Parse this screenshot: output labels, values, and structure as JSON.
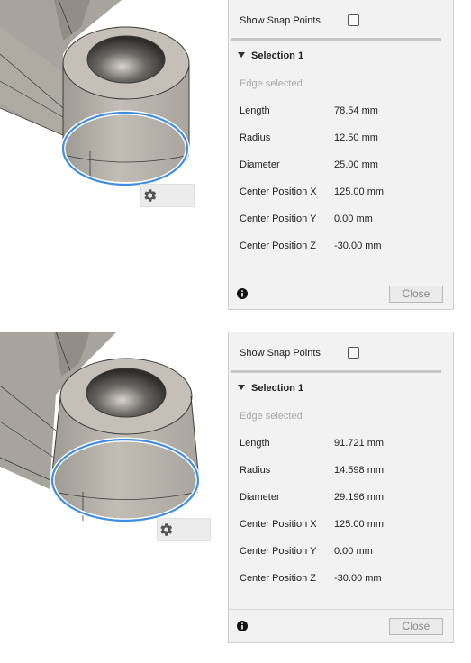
{
  "colors": {
    "accent": "#3e8ee0",
    "part_body": "#b6b2aa",
    "panel_bg": "#f2f2f2"
  },
  "screens": [
    {
      "viewport": {
        "selection_count": "1",
        "gear_icon": "gear-icon"
      },
      "panel": {
        "snap_label": "Show Snap Points",
        "snap_checked": false,
        "selection_title": "Selection 1",
        "status": "Edge selected",
        "props": [
          {
            "name": "Length",
            "value": "78.54 mm"
          },
          {
            "name": "Radius",
            "value": "12.50 mm"
          },
          {
            "name": "Diameter",
            "value": "25.00 mm"
          },
          {
            "name": "Center Position X",
            "value": "125.00 mm"
          },
          {
            "name": "Center Position Y",
            "value": "0.00 mm"
          },
          {
            "name": "Center Position Z",
            "value": "-30.00 mm"
          }
        ],
        "close_label": "Close",
        "info_icon": "info-icon"
      }
    },
    {
      "viewport": {
        "selection_count": "1",
        "gear_icon": "gear-icon"
      },
      "panel": {
        "snap_label": "Show Snap Points",
        "snap_checked": false,
        "selection_title": "Selection 1",
        "status": "Edge selected",
        "props": [
          {
            "name": "Length",
            "value": "91.721 mm"
          },
          {
            "name": "Radius",
            "value": "14.598 mm"
          },
          {
            "name": "Diameter",
            "value": "29.196 mm"
          },
          {
            "name": "Center Position X",
            "value": "125.00 mm"
          },
          {
            "name": "Center Position Y",
            "value": "0.00 mm"
          },
          {
            "name": "Center Position Z",
            "value": "-30.00 mm"
          }
        ],
        "close_label": "Close",
        "info_icon": "info-icon"
      }
    }
  ]
}
